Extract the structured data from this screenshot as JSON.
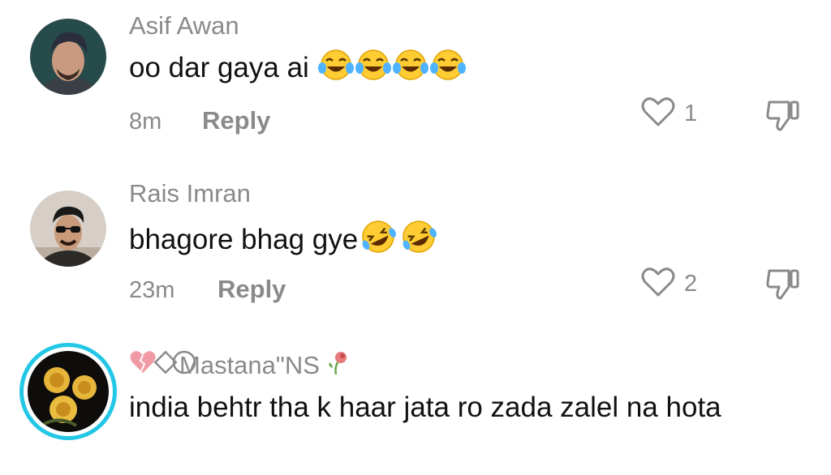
{
  "comments": [
    {
      "username": "Asif Awan",
      "text": "oo dar gaya ai",
      "emojis": [
        "tears-of-joy",
        "tears-of-joy",
        "tears-of-joy",
        "tears-of-joy"
      ],
      "time": "8m",
      "reply_label": "Reply",
      "likes": "1",
      "avatar_colors": {
        "bg": "#274a4a",
        "face": "#c99a7f",
        "hair": "#2a2d3b"
      }
    },
    {
      "username": "Rais Imran",
      "text": "bhagore bhag gye",
      "emojis": [
        "rolling-laughing",
        "rolling-laughing"
      ],
      "time": "23m",
      "reply_label": "Reply",
      "likes": "2",
      "avatar_colors": {
        "bg": "#d7cfc7",
        "face": "#c89a7a",
        "hair": "#1a1a1a"
      }
    },
    {
      "username": "Mastana\"NS",
      "text": "india behtr tha k haar jata ro zada zalel na hota",
      "avatar_colors": {
        "ring": "#22c7e6",
        "bg": "#0e0d0b",
        "rose": "#e6b53a"
      }
    }
  ],
  "icons": {
    "like": "heart-outline-icon",
    "dislike": "thumbs-down-outline-icon"
  },
  "colors": {
    "secondary_text": "#8a8a8a",
    "primary_text": "#111111",
    "story_ring": "#22c7e6"
  }
}
